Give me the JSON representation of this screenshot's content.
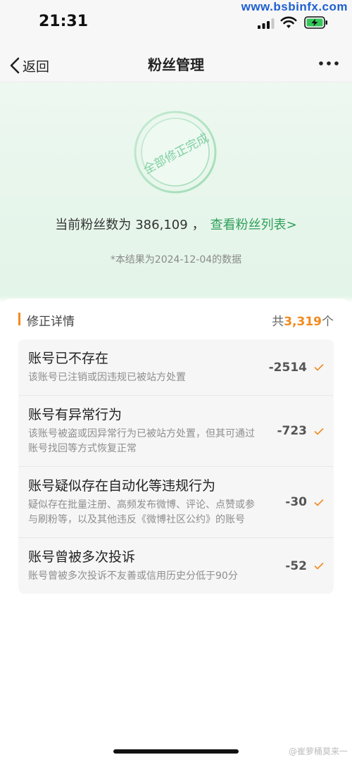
{
  "status_bar": {
    "time": "21:31",
    "watermark": "www.bsbinfx.com",
    "icons": [
      "signal-icon",
      "wifi-icon",
      "battery-charging-icon"
    ]
  },
  "nav": {
    "back_label": "返回",
    "title": "粉丝管理",
    "more_icon": "more-icon"
  },
  "hero": {
    "stamp_text": "全部修正完成",
    "fans_prefix": "当前粉丝数为",
    "fans_count": "386,109",
    "fans_sep": "，",
    "fans_link": "查看粉丝列表>",
    "note": "*本结果为2024-12-04的数据"
  },
  "details": {
    "title": "修正详情",
    "total_prefix": "共",
    "total_count": "3,319",
    "total_suffix": "个",
    "rows": [
      {
        "title": "账号已不存在",
        "desc": "该账号已注销或因违规已被站方处置",
        "value": "-2514"
      },
      {
        "title": "账号有异常行为",
        "desc": "该账号被盗或因异常行为已被站方处置，但其可通过账号找回等方式恢复正常",
        "value": "-723"
      },
      {
        "title": "账号疑似存在自动化等违规行为",
        "desc": "疑似存在批量注册、高频发布微博、评论、点赞或参与刷粉等，以及其他违反《微博社区公约》的账号",
        "value": "-30"
      },
      {
        "title": "账号曾被多次投诉",
        "desc": "账号曾被多次投诉不友善或信用历史分低于90分",
        "value": "-52"
      }
    ]
  },
  "footer": {
    "credit": "@崔萝桶莫来一"
  },
  "colors": {
    "accent_green": "#2ea05a",
    "accent_orange": "#f28a1f",
    "hero_bg": "#e8f6ec"
  }
}
